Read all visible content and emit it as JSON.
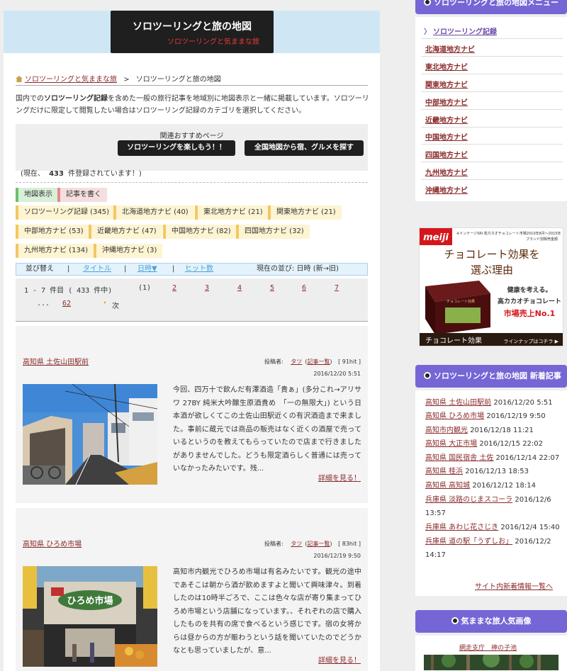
{
  "header": {
    "title": "ソロツーリングと旅の地図",
    "subtitle": "ソロツーリングと気ままな旅"
  },
  "breadcrumb": {
    "home": "ソロツーリングと気ままな旅",
    "separator": ">",
    "current": "ソロツーリングと旅の地図"
  },
  "intro": {
    "prefix": "国内での",
    "bold": "ソロツーリング記録",
    "text": "を含めた一般の旅行記事を地域別に地図表示と一緒に掲載しています。ソロツーリングだけに限定して閲覧したい場合はソロツーリング記録のカテゴリを選択してください。"
  },
  "recommend": {
    "label": "関連おすすめページ",
    "button1": "ソロツーリングを楽しもう！！",
    "button2": "全国地図から宿、グルメを探す"
  },
  "count": {
    "prefix": "(現在、",
    "number": "433",
    "suffix": "件登録されています！)"
  },
  "actions": {
    "map_view": "地図表示",
    "write_article": "記事を書く"
  },
  "categories": [
    "ソロツーリング記録 (345)",
    "北海道地方ナビ (40)",
    "東北地方ナビ (21)",
    "関東地方ナビ (21)",
    "中部地方ナビ (53)",
    "近畿地方ナビ (47)",
    "中国地方ナビ (82)",
    "四国地方ナビ (32)",
    "九州地方ナビ (134)",
    "沖縄地方ナビ (3)"
  ],
  "sort": {
    "label": "並び替え",
    "sep": "|",
    "title": "タイトル",
    "date": "日時▼",
    "hits": "ヒット数",
    "current": "現在の並び: 日時 (新→旧)"
  },
  "pager": {
    "range": "1 - 7 件目 ( 433 件中)",
    "current": "(1)",
    "pages": [
      "2",
      "3",
      "4",
      "5",
      "6",
      "7"
    ],
    "ellipsis": "...",
    "last": "62",
    "next_arrow": "▸",
    "next": "次"
  },
  "posts": [
    {
      "title": "高知県 土佐山田駅前",
      "author_label": "投稿者:",
      "author": "タツ",
      "list_open": "(",
      "list": "記事一覧",
      "list_close": ")",
      "hits": "[ 91hit ]",
      "date": "2016/12/20 5:51",
      "body": "今回、四万十で飲んだ有澤酒造「貴ぁ」(多分これ→アリサワ 27BY 純米大吟醸生原酒貴め　「一の無限大」) という日本酒が欲しくてこの土佐山田駅近くの有沢酒造まで来ました。事前に蔵元では商品の販売はなく近くの酒屋で売っているというのを教えてもらっていたので店まで行きましたがありませんでした。どうも限定酒らしく普通には売っていなかったみたいです。残...",
      "more": "詳細を見る！"
    },
    {
      "title": "高知県 ひろめ市場",
      "author_label": "投稿者:",
      "author": "タツ",
      "list_open": "(",
      "list": "記事一覧",
      "list_close": ")",
      "hits": "[ 83hit ]",
      "date": "2016/12/19 9:50",
      "body": "高知市内観光でひろめ市場は有名みたいです。観光の途中であそこは朝から酒が飲めますよと聞いて興味津々。到着したのは10時半ごろで、ここは色々な店が寄り集まってひろめ市場という店舗になっています。、それぞれの店で購入したものを共有の席で食べるという感じです。宿の女将からは昼からの方が賑わうという話を聞いていたのでどうかなとも思っていましたが、意...",
      "more": "詳細を見る！"
    }
  ],
  "post2_sign": "ひろめ市場",
  "sidebar": {
    "menu_title": "ソロツーリングと旅の地図メニュー",
    "menu_arrow": "〉",
    "menu": [
      "ソロツーリング記録",
      "北海道地方ナビ",
      "東北地方ナビ",
      "関東地方ナビ",
      "中部地方ナビ",
      "近畿地方ナビ",
      "中国地方ナビ",
      "四国地方ナビ",
      "九州地方ナビ",
      "沖縄地方ナビ"
    ],
    "ad": {
      "brand": "meiji",
      "small": "※インテージSRI 高カカオチョコレート市場2010年8月〜2015年",
      "small2": "ブランド別販売金額",
      "headline1": "チョコレート効果を",
      "headline2": "選ぶ理由",
      "line1": "健康を考える。",
      "line2": "高カカオチョコレート",
      "line3": "市場売上No.1",
      "footer": "チョコレート効果",
      "footer_link": "ラインナップはコチラ ▶",
      "box_label": "チョコレート効果"
    },
    "new_title": "ソロツーリングと旅の地図 新着記事",
    "new_posts": [
      {
        "title": "高知県 土佐山田駅前",
        "date": "2016/12/20 5:51"
      },
      {
        "title": "高知県 ひろめ市場",
        "date": "2016/12/19 9:50"
      },
      {
        "title": "高知市内観光",
        "date": "2016/12/18 11:21"
      },
      {
        "title": "高知県 大正市場",
        "date": "2016/12/15 22:02"
      },
      {
        "title": "高知県 国民宿舎 土佐",
        "date": "2016/12/14 22:07"
      },
      {
        "title": "高知県 桂浜",
        "date": "2016/12/13 18:53"
      },
      {
        "title": "高知県 高知城",
        "date": "2016/12/12 18:14"
      },
      {
        "title": "兵庫県 淡路のじまスコーラ",
        "date": "2016/12/6 13:57"
      },
      {
        "title": "兵庫県 あわじ花さじき",
        "date": "2016/12/4 15:40"
      },
      {
        "title": "兵庫県 道の駅「うずしお」",
        "date": "2016/12/2 14:17"
      }
    ],
    "all_news": "サイト内新着情報一覧へ",
    "popular_title": "気ままな旅人気画像",
    "popular_caption": "網走支庁　神の子池"
  }
}
